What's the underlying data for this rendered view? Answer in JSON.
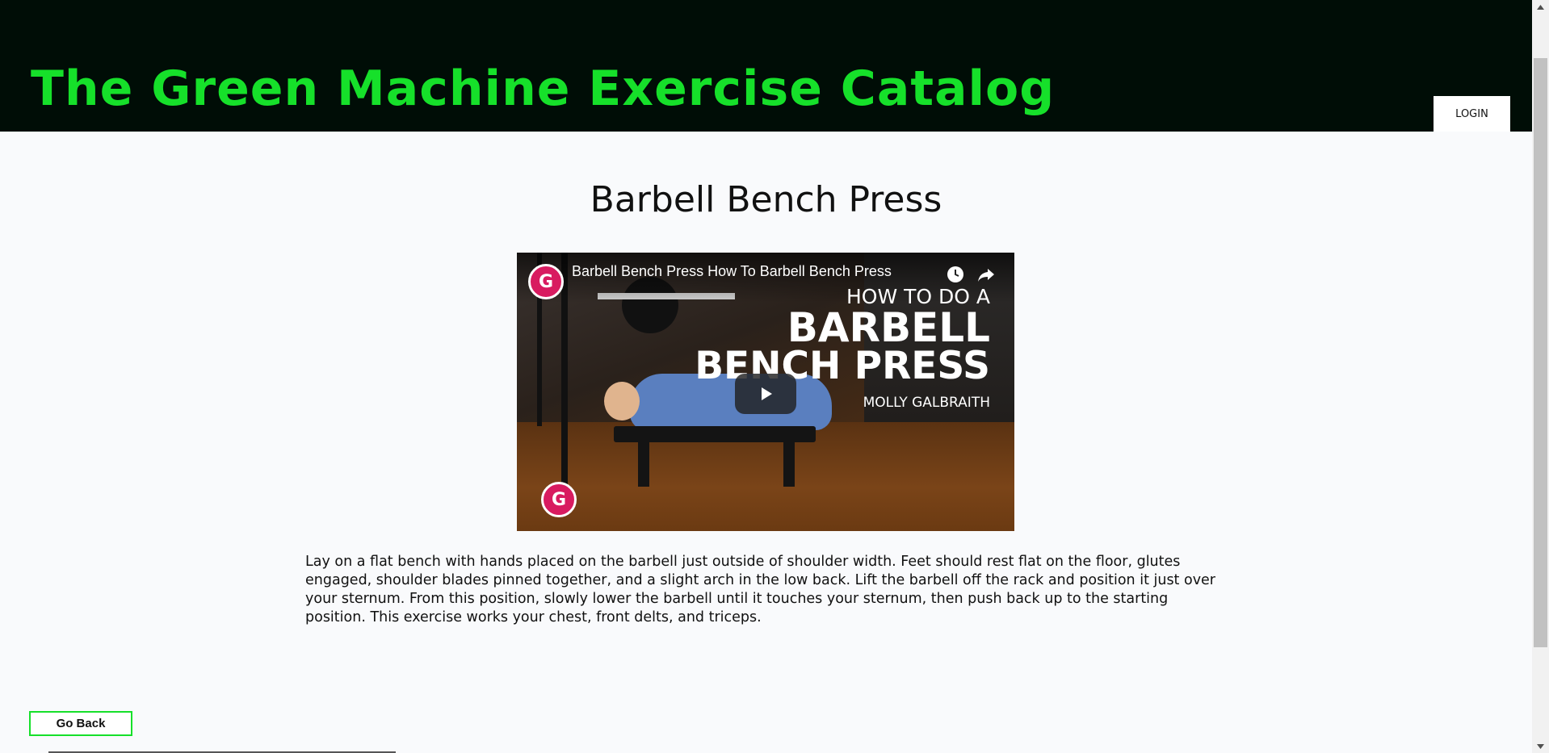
{
  "header": {
    "site_title": "The Green Machine Exercise Catalog",
    "login_label": "LOGIN"
  },
  "exercise": {
    "title": "Barbell Bench Press",
    "description": "Lay on a flat bench with hands placed on the barbell just outside of shoulder width. Feet should rest flat on the floor, glutes engaged, shoulder blades pinned together, and a slight arch in the low back. Lift the barbell off the rack and position it just over your sternum. From this position, slowly lower the barbell until it touches your sternum, then push back up to the starting position. This exercise works your chest, front delts, and triceps."
  },
  "video": {
    "title": "Barbell Bench Press How To Barbell Bench Press",
    "overlay_line1": "HOW TO DO A",
    "overlay_line2": "BARBELL",
    "overlay_line3": "BENCH PRESS",
    "overlay_line4": "MOLLY GALBRAITH",
    "channel_logo_letter": "G",
    "icons": [
      "watch-later-icon",
      "share-icon",
      "play-icon"
    ]
  },
  "footer": {
    "go_back_label": "Go Back"
  },
  "colors": {
    "header_bg": "#000d06",
    "accent_green": "#16e02a",
    "page_bg": "#f9fafc",
    "logo_pink": "#d81b60"
  }
}
